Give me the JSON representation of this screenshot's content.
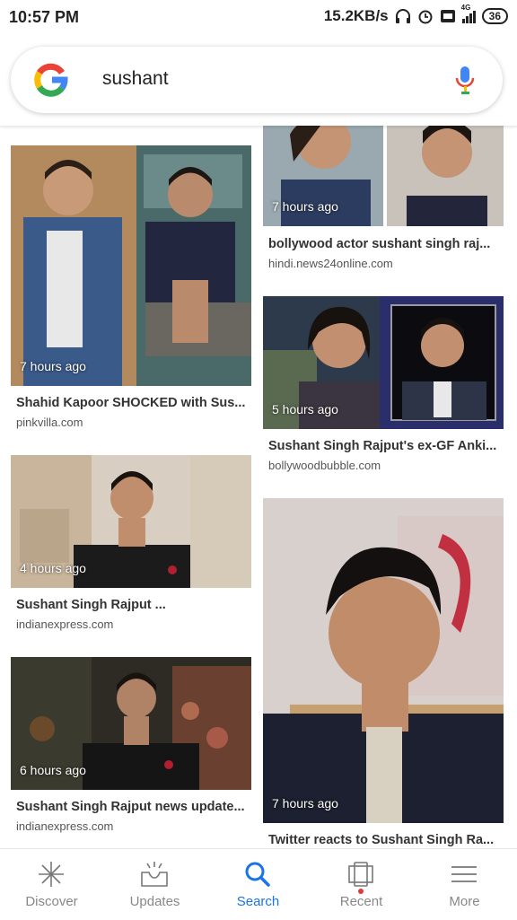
{
  "status_bar": {
    "time": "10:57 PM",
    "speed": "15.2KB/s",
    "network": "4G",
    "battery": "36",
    "icons": [
      "headphones-icon",
      "alarm-icon",
      "hd-icon",
      "signal-icon",
      "battery-icon"
    ]
  },
  "search": {
    "query": "sushant",
    "logo": "google-g-logo",
    "mic_icon": "mic-icon"
  },
  "feed": {
    "left": [
      {
        "time": "7 hours ago",
        "title": "Shahid Kapoor SHOCKED with Sus...",
        "source": "pinkvilla.com"
      },
      {
        "time": "4 hours ago",
        "title": "Sushant Singh Rajput ...",
        "source": "indianexpress.com"
      },
      {
        "time": "6 hours ago",
        "title": "Sushant Singh Rajput news update...",
        "source": "indianexpress.com"
      }
    ],
    "right": [
      {
        "time": "7 hours ago",
        "title": "bollywood actor sushant singh raj...",
        "source": "hindi.news24online.com"
      },
      {
        "time": "5 hours ago",
        "title": "Sushant Singh Rajput's ex-GF Anki...",
        "source": "bollywoodbubble.com"
      },
      {
        "time": "7 hours ago",
        "title": "Twitter reacts to Sushant Singh Ra...",
        "source": ""
      }
    ]
  },
  "nav": {
    "items": [
      {
        "label": "Discover",
        "icon": "asterisk-icon"
      },
      {
        "label": "Updates",
        "icon": "inbox-icon"
      },
      {
        "label": "Search",
        "icon": "search-icon"
      },
      {
        "label": "Recent",
        "icon": "cards-icon"
      },
      {
        "label": "More",
        "icon": "menu-icon"
      }
    ],
    "active": "Search"
  },
  "colors": {
    "accent": "#1a73e8",
    "nav_inactive": "#888888",
    "text": "#333333"
  }
}
